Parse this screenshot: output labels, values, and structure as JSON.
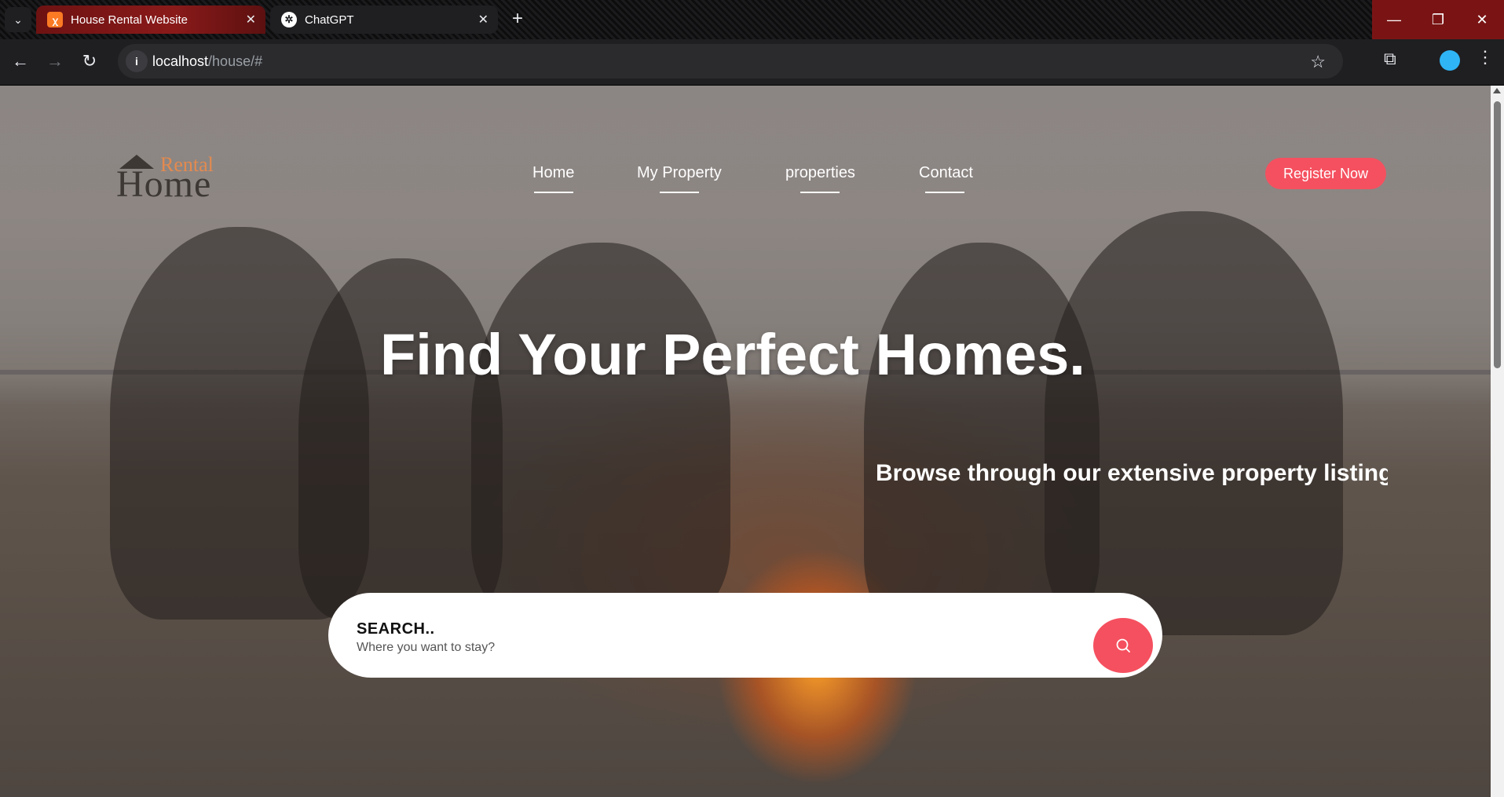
{
  "browser": {
    "tabs": [
      {
        "title": "House Rental Website",
        "icon": "xampp-icon",
        "active": true
      },
      {
        "title": "ChatGPT",
        "icon": "openai-icon",
        "active": false
      }
    ],
    "url_host": "localhost",
    "url_path": "/house/#",
    "window_controls": {
      "minimize": "—",
      "restore": "❐",
      "close": "✕"
    }
  },
  "site": {
    "logo": {
      "word_top": "Rental",
      "word_bottom": "Home"
    },
    "nav": [
      "Home",
      "My Property",
      "properties",
      "Contact"
    ],
    "register_label": "Register Now",
    "hero_title": "Find Your Perfect Homes.",
    "hero_subtitle": "Browse through our extensive property listing",
    "search": {
      "label": "SEARCH..",
      "placeholder": "Where you want to stay?"
    }
  },
  "colors": {
    "accent": "#f5505f",
    "logo_accent": "#e38a4f",
    "active_tab": "#8a1a1a"
  }
}
